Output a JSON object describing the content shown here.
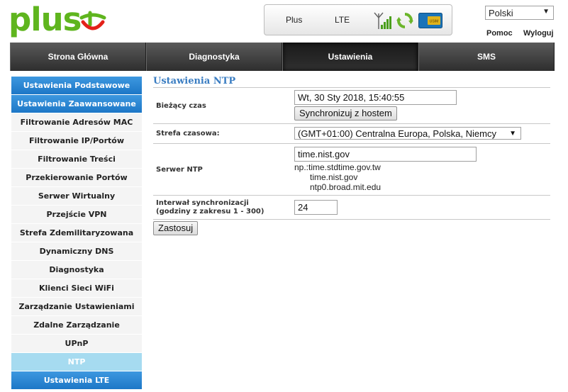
{
  "brand": {
    "logo_text": "plus"
  },
  "status": {
    "operator": "Plus",
    "network": "LTE",
    "sim_label": "USIM"
  },
  "language": {
    "selected": "Polski"
  },
  "header_links": {
    "help": "Pomoc",
    "logout": "Wyloguj"
  },
  "topnav": [
    {
      "label": "Strona Główna"
    },
    {
      "label": "Diagnostyka"
    },
    {
      "label": "Ustawienia"
    },
    {
      "label": "SMS"
    }
  ],
  "topnav_active": "Ustawienia",
  "sidebar": [
    {
      "label": "Ustawienia Podstawowe"
    },
    {
      "label": "Ustawienia Zaawansowane"
    },
    {
      "label": "Filtrowanie Adresów MAC"
    },
    {
      "label": "Filtrowanie IP/Portów"
    },
    {
      "label": "Filtrowanie Treści"
    },
    {
      "label": "Przekierowanie Portów"
    },
    {
      "label": "Serwer Wirtualny"
    },
    {
      "label": "Przejście VPN"
    },
    {
      "label": "Strefa Zdemilitaryzowana"
    },
    {
      "label": "Dynamiczny DNS"
    },
    {
      "label": "Diagnostyka"
    },
    {
      "label": "Klienci Sieci WiFi"
    },
    {
      "label": "Zarządzanie Ustawieniami"
    },
    {
      "label": "Zdalne Zarządzanie"
    },
    {
      "label": "UPnP"
    },
    {
      "label": "NTP"
    },
    {
      "label": "Ustawienia LTE"
    }
  ],
  "sidebar_active": "NTP",
  "ntp": {
    "title": "Ustawienia NTP",
    "current_time_label": "Bieżący czas",
    "current_time_value": "Wt, 30 Sty 2018, 15:40:55",
    "sync_button": "Synchronizuj z hostem",
    "timezone_label": "Strefa czasowa:",
    "timezone_value": "(GMT+01:00) Centralna Europa, Polska, Niemcy",
    "server_label": "Serwer NTP",
    "server_value": "time.nist.gov",
    "server_hint_1": "np.:time.stdtime.gov.tw",
    "server_hint_2": "time.nist.gov",
    "server_hint_3": "ntp0.broad.mit.edu",
    "interval_label_1": "Interwał synchronizacji",
    "interval_label_2": "(godziny z zakresu 1 - 300)",
    "interval_value": "24",
    "apply_button": "Zastosuj"
  },
  "colors": {
    "brand_green": "#5fb51e",
    "accent_blue": "#1d77c7",
    "active_light_blue": "#a6dbf0",
    "title_blue": "#3a7dc2"
  }
}
